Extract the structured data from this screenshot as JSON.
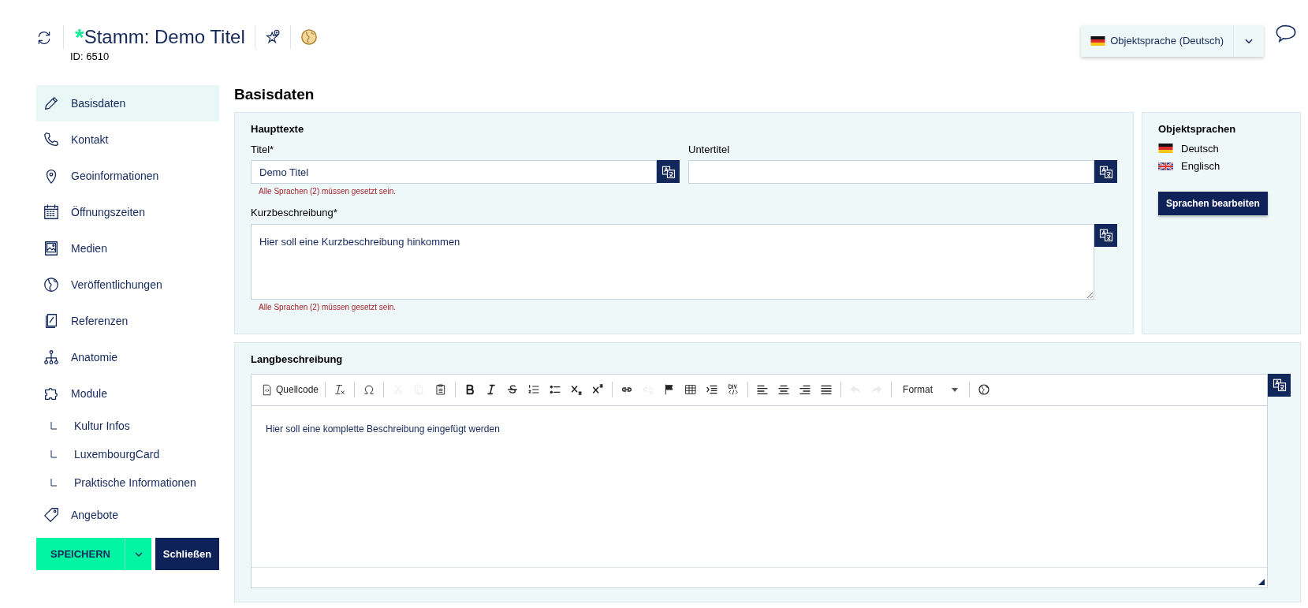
{
  "header": {
    "required_mark": "*",
    "title": "Stamm: Demo Titel",
    "id_label": "ID: 6510"
  },
  "language_selector": {
    "label": "Objektsprache (Deutsch)"
  },
  "sidebar": {
    "items": [
      {
        "label": "Basisdaten",
        "selected": true
      },
      {
        "label": "Kontakt",
        "selected": false
      },
      {
        "label": "Geoinformationen",
        "selected": false
      },
      {
        "label": "Öffnungszeiten",
        "selected": false
      },
      {
        "label": "Medien",
        "selected": false
      },
      {
        "label": "Veröffentlichungen",
        "selected": false
      },
      {
        "label": "Referenzen",
        "selected": false
      },
      {
        "label": "Anatomie",
        "selected": false
      },
      {
        "label": "Module",
        "selected": false,
        "children": [
          {
            "label": "Kultur Infos",
            "selected": false
          },
          {
            "label": "LuxembourgCard",
            "selected": false
          },
          {
            "label": "Praktische Informationen",
            "selected": false
          }
        ]
      },
      {
        "label": "Angebote",
        "selected": false
      }
    ],
    "save_button": "SPEICHERN",
    "close_button": "Schließen"
  },
  "page_title": "Basisdaten",
  "main_texts": {
    "title": "Haupttexte",
    "fields": [
      {
        "label": "Titel*",
        "value": "Demo Titel",
        "error": "Alle Sprachen (2) müssen gesetzt sein."
      },
      {
        "label": "Untertitel"
      }
    ],
    "short_description": {
      "label": "Kurzbeschreibung*",
      "value": "Hier soll eine Kurzbeschreibung hinkommen",
      "error": "Alle Sprachen (2) müssen gesetzt sein."
    }
  },
  "object_languages": {
    "title": "Objektsprachen",
    "languages": [
      {
        "name": "Deutsch"
      },
      {
        "name": "Englisch"
      }
    ],
    "edit_button": "Sprachen bearbeiten"
  },
  "long_description": {
    "title": "Langbeschreibung",
    "toolbar": [
      {
        "kind": "labeled",
        "label": "Quellcode",
        "disabled": false
      },
      {
        "kind": "separator"
      },
      {
        "kind": "icon",
        "disabled": false
      },
      {
        "kind": "separator"
      },
      {
        "kind": "icon",
        "disabled": false
      },
      {
        "kind": "separator"
      },
      {
        "kind": "icon",
        "disabled": true
      },
      {
        "kind": "icon",
        "disabled": true
      },
      {
        "kind": "icon",
        "disabled": false
      },
      {
        "kind": "separator"
      },
      {
        "kind": "icon",
        "disabled": false
      },
      {
        "kind": "icon",
        "disabled": false
      },
      {
        "kind": "icon",
        "disabled": false
      },
      {
        "kind": "icon",
        "disabled": false
      },
      {
        "kind": "icon",
        "disabled": false
      },
      {
        "kind": "icon",
        "disabled": false
      },
      {
        "kind": "icon",
        "disabled": false
      },
      {
        "kind": "separator"
      },
      {
        "kind": "icon",
        "disabled": false
      },
      {
        "kind": "icon",
        "disabled": true
      },
      {
        "kind": "icon",
        "disabled": false
      },
      {
        "kind": "icon",
        "disabled": false
      },
      {
        "kind": "icon",
        "disabled": false
      },
      {
        "kind": "icon",
        "disabled": false
      },
      {
        "kind": "separator"
      },
      {
        "kind": "icon",
        "disabled": false
      },
      {
        "kind": "icon",
        "disabled": false
      },
      {
        "kind": "icon",
        "disabled": false
      },
      {
        "kind": "icon",
        "disabled": false
      },
      {
        "kind": "separator"
      },
      {
        "kind": "icon",
        "disabled": true
      },
      {
        "kind": "icon",
        "disabled": true
      },
      {
        "kind": "separator"
      },
      {
        "kind": "dropdown",
        "label": "Format",
        "disabled": false
      },
      {
        "kind": "separator"
      },
      {
        "kind": "icon",
        "disabled": false
      }
    ],
    "content": "Hier soll eine komplette Beschreibung eingefügt werden"
  }
}
